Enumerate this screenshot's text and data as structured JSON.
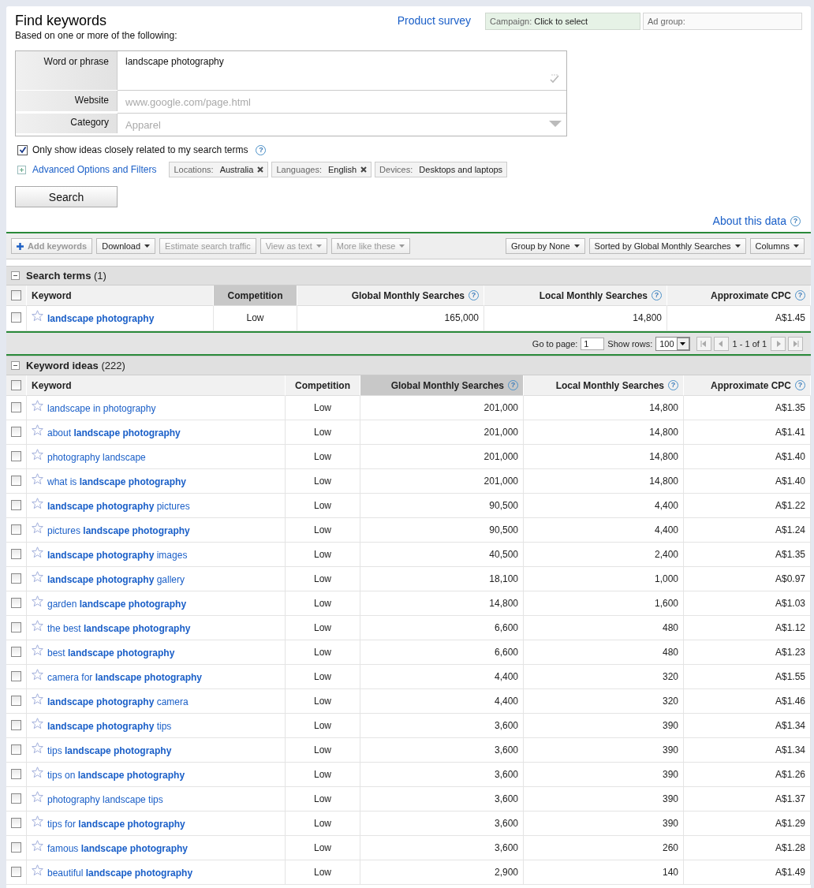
{
  "header": {
    "title": "Find keywords",
    "subtitle": "Based on one or more of the following:",
    "survey_link": "Product survey",
    "campaign": {
      "label": "Campaign:",
      "value": "Click to select"
    },
    "ad_group": {
      "label": "Ad group:"
    }
  },
  "form": {
    "fields": [
      {
        "kind": "textarea",
        "label": "Word or phrase",
        "value": "landscape photography"
      },
      {
        "kind": "text",
        "label": "Website",
        "placeholder": "www.google.com/page.html"
      },
      {
        "kind": "select",
        "label": "Category",
        "placeholder": "Apparel"
      }
    ]
  },
  "closely_related": {
    "label": "Only show ideas closely related to my search terms",
    "checked": true,
    "help": "?"
  },
  "advanced": {
    "label": "Advanced Options and Filters",
    "expanded": false
  },
  "filters": [
    {
      "label": "Locations:",
      "value": "Australia",
      "removable": true
    },
    {
      "label": "Languages:",
      "value": "English",
      "removable": true
    },
    {
      "label": "Devices:",
      "value": "Desktops and laptops",
      "removable": false
    }
  ],
  "search_button": "Search",
  "about": {
    "label": "About this data",
    "help": "?"
  },
  "toolbar": {
    "left": [
      {
        "kind": "add",
        "label": "Add keywords",
        "disabled": true
      },
      {
        "kind": "menu",
        "label": "Download",
        "disabled": false
      },
      {
        "kind": "plain",
        "label": "Estimate search traffic",
        "disabled": true
      },
      {
        "kind": "menu",
        "label": "View as text",
        "disabled": true
      },
      {
        "kind": "menu",
        "label": "More like these",
        "disabled": true
      }
    ],
    "right": [
      {
        "kind": "menu",
        "label": "Group by None",
        "disabled": false
      },
      {
        "kind": "menu",
        "label": "Sorted by Global Monthly Searches",
        "disabled": false
      },
      {
        "kind": "menu",
        "label": "Columns",
        "disabled": false
      }
    ]
  },
  "search_terms": {
    "title": "Search terms",
    "count": "(1)",
    "expanded": true,
    "all_checked": false,
    "columns": [
      {
        "label": "Keyword",
        "sorted": false
      },
      {
        "label": "Competition",
        "sorted": true
      },
      {
        "label": "Global Monthly Searches",
        "help": "?",
        "sorted": false
      },
      {
        "label": "Local Monthly Searches",
        "help": "?",
        "sorted": false
      },
      {
        "label": "Approximate CPC",
        "help": "?",
        "sorted": false
      }
    ],
    "rows": [
      {
        "keyword": "landscape photography",
        "checked": false,
        "starred": false,
        "competition": "Low",
        "global": "165,000",
        "local": "14,800",
        "cpc": "A$1.45"
      }
    ]
  },
  "pager": {
    "goto_label": "Go to page:",
    "page": "1",
    "rows_label": "Show rows:",
    "rows": "100",
    "range": "1 - 1 of 1"
  },
  "keyword_ideas": {
    "title": "Keyword ideas",
    "count": "(222)",
    "expanded": true,
    "all_checked": false,
    "columns": [
      {
        "label": "Keyword",
        "sorted": false
      },
      {
        "label": "Competition",
        "sorted": false
      },
      {
        "label": "Global Monthly Searches",
        "help": "?",
        "sorted": true
      },
      {
        "label": "Local Monthly Searches",
        "help": "?",
        "sorted": false
      },
      {
        "label": "Approximate CPC",
        "help": "?",
        "sorted": false
      }
    ],
    "rows": [
      {
        "keyword": "landscape in photography",
        "checked": false,
        "starred": false,
        "competition": "Low",
        "global": "201,000",
        "local": "14,800",
        "cpc": "A$1.35"
      },
      {
        "keyword": "about **landscape photography**",
        "checked": false,
        "starred": false,
        "competition": "Low",
        "global": "201,000",
        "local": "14,800",
        "cpc": "A$1.41"
      },
      {
        "keyword": "photography landscape",
        "checked": false,
        "starred": false,
        "competition": "Low",
        "global": "201,000",
        "local": "14,800",
        "cpc": "A$1.40"
      },
      {
        "keyword": "what is **landscape photography**",
        "checked": false,
        "starred": false,
        "competition": "Low",
        "global": "201,000",
        "local": "14,800",
        "cpc": "A$1.40"
      },
      {
        "keyword": "**landscape photography** pictures",
        "checked": false,
        "starred": false,
        "competition": "Low",
        "global": "90,500",
        "local": "4,400",
        "cpc": "A$1.22"
      },
      {
        "keyword": "pictures **landscape photography**",
        "checked": false,
        "starred": false,
        "competition": "Low",
        "global": "90,500",
        "local": "4,400",
        "cpc": "A$1.24"
      },
      {
        "keyword": "**landscape photography** images",
        "checked": false,
        "starred": false,
        "competition": "Low",
        "global": "40,500",
        "local": "2,400",
        "cpc": "A$1.35"
      },
      {
        "keyword": "**landscape photography** gallery",
        "checked": false,
        "starred": false,
        "competition": "Low",
        "global": "18,100",
        "local": "1,000",
        "cpc": "A$0.97"
      },
      {
        "keyword": "garden **landscape photography**",
        "checked": false,
        "starred": false,
        "competition": "Low",
        "global": "14,800",
        "local": "1,600",
        "cpc": "A$1.03"
      },
      {
        "keyword": "the best **landscape photography**",
        "checked": false,
        "starred": false,
        "competition": "Low",
        "global": "6,600",
        "local": "480",
        "cpc": "A$1.12"
      },
      {
        "keyword": "best **landscape photography**",
        "checked": false,
        "starred": false,
        "competition": "Low",
        "global": "6,600",
        "local": "480",
        "cpc": "A$1.23"
      },
      {
        "keyword": "camera for **landscape photography**",
        "checked": false,
        "starred": false,
        "competition": "Low",
        "global": "4,400",
        "local": "320",
        "cpc": "A$1.55"
      },
      {
        "keyword": "**landscape photography** camera",
        "checked": false,
        "starred": false,
        "competition": "Low",
        "global": "4,400",
        "local": "320",
        "cpc": "A$1.46"
      },
      {
        "keyword": "**landscape photography** tips",
        "checked": false,
        "starred": false,
        "competition": "Low",
        "global": "3,600",
        "local": "390",
        "cpc": "A$1.34"
      },
      {
        "keyword": "tips **landscape photography**",
        "checked": false,
        "starred": false,
        "competition": "Low",
        "global": "3,600",
        "local": "390",
        "cpc": "A$1.34"
      },
      {
        "keyword": "tips on **landscape photography**",
        "checked": false,
        "starred": false,
        "competition": "Low",
        "global": "3,600",
        "local": "390",
        "cpc": "A$1.26"
      },
      {
        "keyword": "photography landscape tips",
        "checked": false,
        "starred": false,
        "competition": "Low",
        "global": "3,600",
        "local": "390",
        "cpc": "A$1.37"
      },
      {
        "keyword": "tips for **landscape photography**",
        "checked": false,
        "starred": false,
        "competition": "Low",
        "global": "3,600",
        "local": "390",
        "cpc": "A$1.29"
      },
      {
        "keyword": "famous **landscape photography**",
        "checked": false,
        "starred": false,
        "competition": "Low",
        "global": "3,600",
        "local": "260",
        "cpc": "A$1.28"
      },
      {
        "keyword": "beautiful **landscape photography**",
        "checked": false,
        "starred": false,
        "competition": "Low",
        "global": "2,900",
        "local": "140",
        "cpc": "A$1.49"
      }
    ]
  }
}
